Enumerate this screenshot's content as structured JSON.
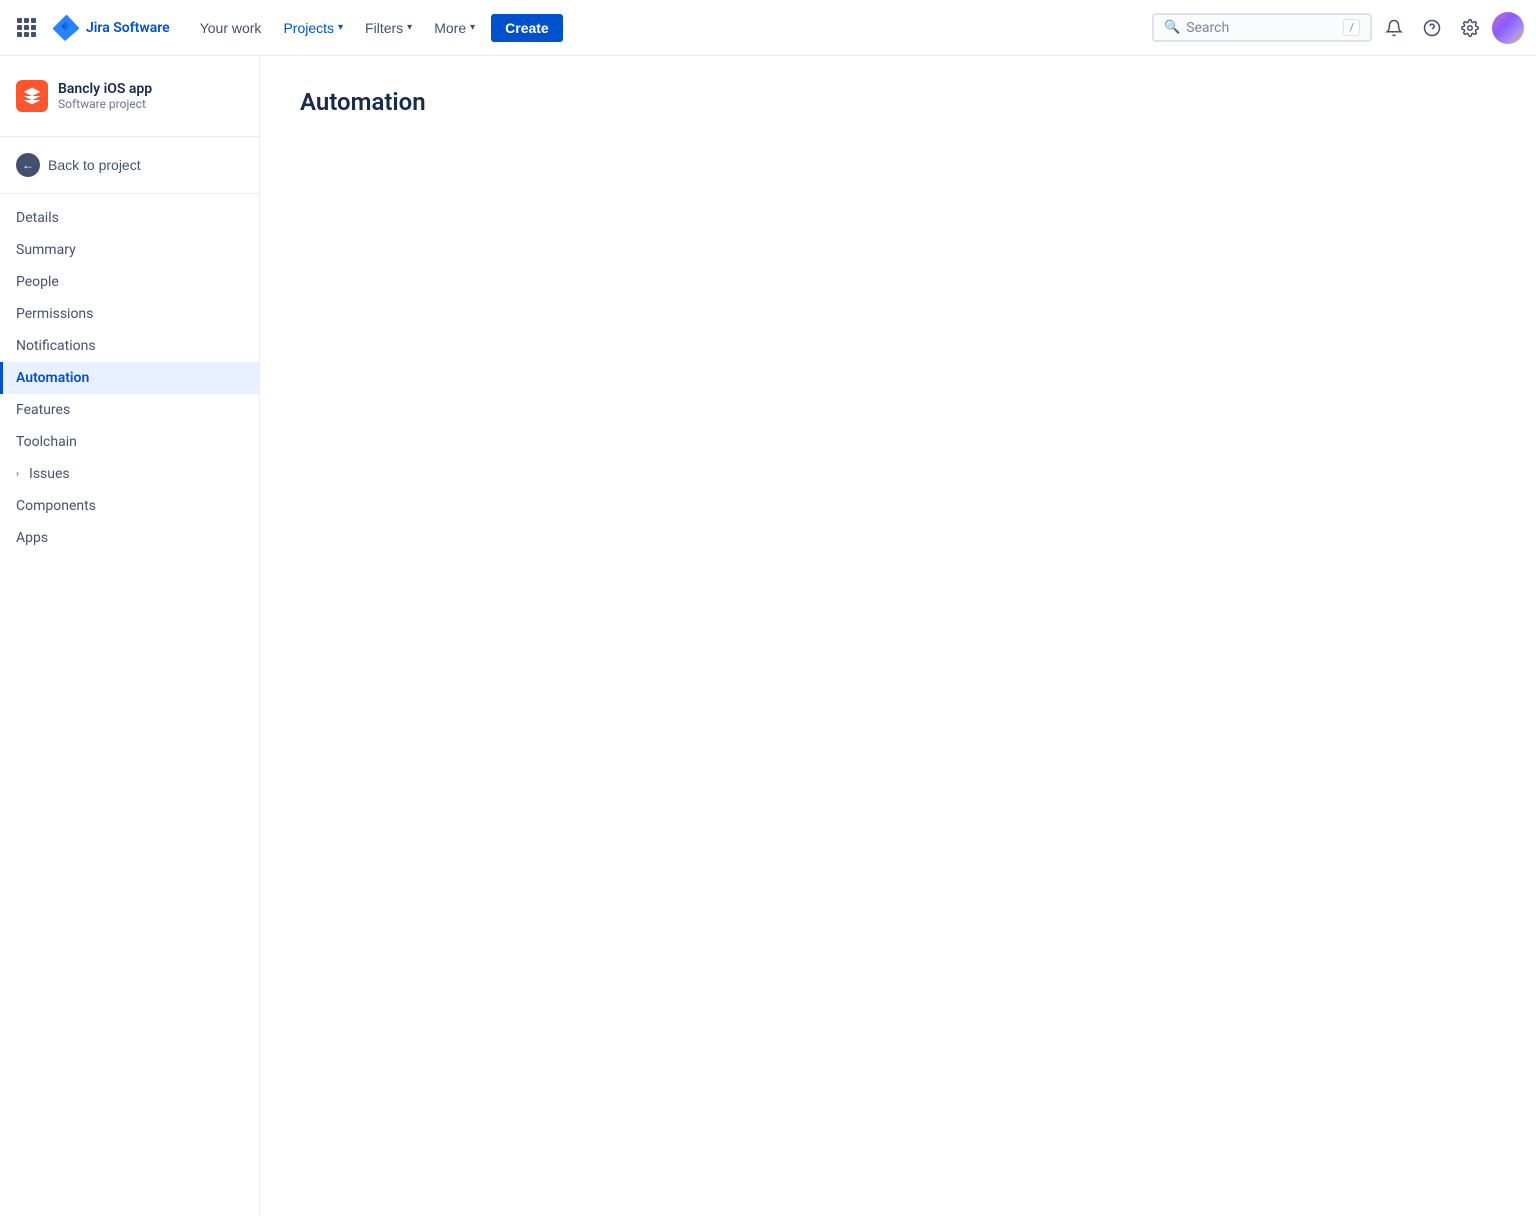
{
  "topnav": {
    "logo_text": "Jira Software",
    "nav_items": [
      {
        "id": "your-work",
        "label": "Your work"
      },
      {
        "id": "projects",
        "label": "Projects",
        "has_chevron": true,
        "active": true
      },
      {
        "id": "filters",
        "label": "Filters",
        "has_chevron": true
      },
      {
        "id": "more",
        "label": "More",
        "has_chevron": true
      }
    ],
    "create_label": "Create",
    "search_placeholder": "Search",
    "search_shortcut": "/",
    "notifications_icon": "🔔",
    "help_icon": "?",
    "settings_icon": "⚙"
  },
  "sidebar": {
    "project_name": "Bancly iOS app",
    "project_type": "Software project",
    "back_label": "Back to project",
    "nav_items": [
      {
        "id": "details",
        "label": "Details",
        "active": false
      },
      {
        "id": "summary",
        "label": "Summary",
        "active": false
      },
      {
        "id": "people",
        "label": "People",
        "active": false
      },
      {
        "id": "permissions",
        "label": "Permissions",
        "active": false
      },
      {
        "id": "notifications",
        "label": "Notifications",
        "active": false
      },
      {
        "id": "automation",
        "label": "Automation",
        "active": true
      },
      {
        "id": "features",
        "label": "Features",
        "active": false
      },
      {
        "id": "toolchain",
        "label": "Toolchain",
        "active": false
      },
      {
        "id": "issues",
        "label": "Issues",
        "active": false,
        "expandable": true
      },
      {
        "id": "components",
        "label": "Components",
        "active": false
      },
      {
        "id": "apps",
        "label": "Apps",
        "active": false
      }
    ]
  },
  "main": {
    "page_title": "Automation"
  }
}
